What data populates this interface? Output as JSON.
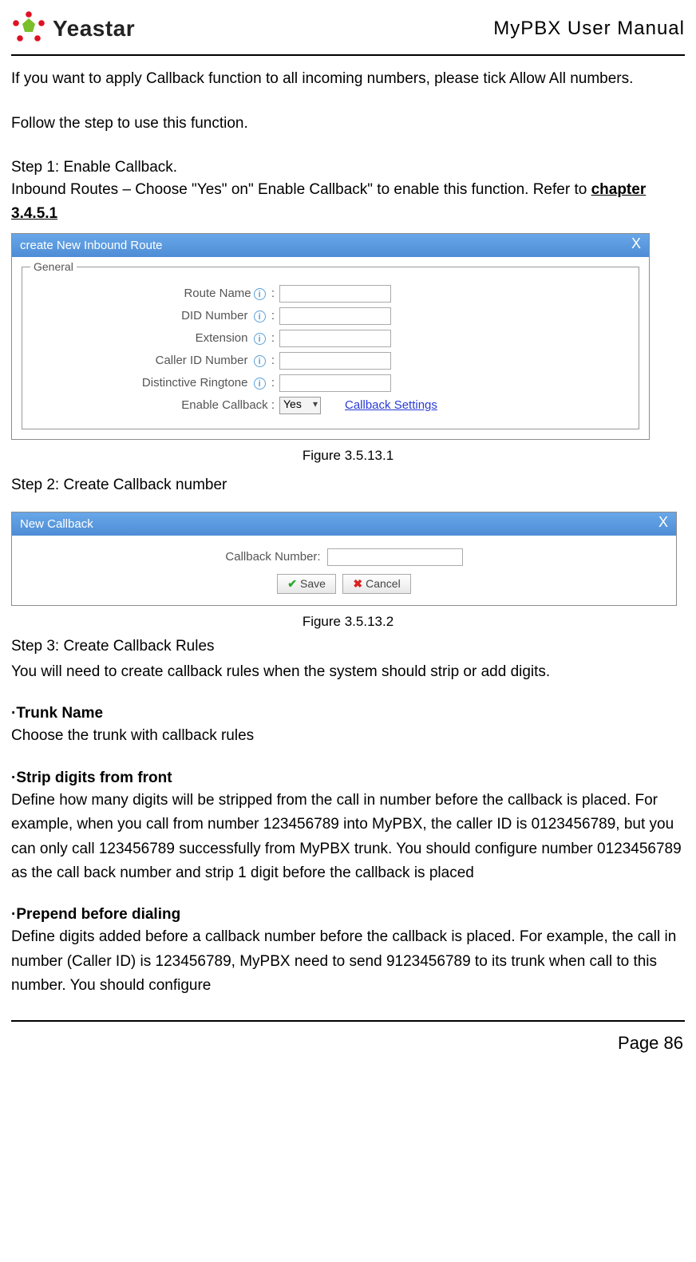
{
  "header": {
    "brand": "Yeastar",
    "title": "MyPBX User Manual"
  },
  "intro": {
    "p1": "If you want to apply Callback function to all incoming numbers, please tick Allow All numbers.",
    "p2": "Follow the step to use this function."
  },
  "step1": {
    "title": "Step 1: Enable Callback.",
    "desc": "Inbound Routes – Choose \"Yes\" on\" Enable Callback\" to enable this function. Refer to ",
    "ref": "chapter 3.4.5.1"
  },
  "modal1": {
    "title": "create New Inbound Route",
    "legend": "General",
    "labels": {
      "route_name": "Route Name",
      "did_number": "DID Number",
      "extension": "Extension",
      "caller_id": "Caller ID Number",
      "distinctive_ringtone": "Distinctive Ringtone",
      "enable_callback": "Enable Callback :"
    },
    "enable_callback_value": "Yes",
    "callback_settings_link": "Callback Settings",
    "caption": "Figure 3.5.13.1"
  },
  "step2": {
    "title": "Step 2: Create Callback number"
  },
  "modal2": {
    "title": "New Callback",
    "label": "Callback Number:",
    "save": "Save",
    "cancel": "Cancel",
    "caption": "Figure 3.5.13.2"
  },
  "step3": {
    "title": "Step 3: Create Callback Rules",
    "desc": "You will need to create callback rules when the system should strip or add digits."
  },
  "trunk": {
    "title": "·Trunk Name",
    "desc": "Choose the trunk with callback rules"
  },
  "strip": {
    "title": "·Strip digits from front",
    "desc": "Define how many digits will be stripped from the call in number before the callback is placed. For example, when you call from number 123456789 into MyPBX, the caller ID is 0123456789, but you can only call 123456789 successfully from MyPBX trunk. You should configure number 0123456789 as the call back number and strip 1 digit before the callback is placed"
  },
  "prepend": {
    "title": "·Prepend before dialing",
    "desc": "Define digits added before a callback number before the callback is placed. For example, the call in number (Caller ID) is 123456789, MyPBX need to send 9123456789 to its trunk when call to this number. You should configure"
  },
  "footer": {
    "page": "Page 86"
  }
}
